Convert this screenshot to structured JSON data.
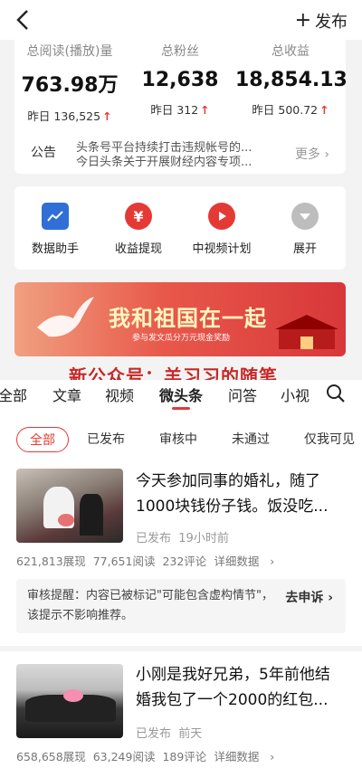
{
  "header": {
    "publish_label": "发布",
    "back_icon": "back-arrow-icon"
  },
  "stats": [
    {
      "label": "总阅读(播放)量",
      "value": "763.98万",
      "yesterday": "昨日 136,525"
    },
    {
      "label": "总粉丝",
      "value": "12,638",
      "yesterday": "昨日 312"
    },
    {
      "label": "总收益",
      "value": "18,854.13",
      "yesterday": "昨日 500.72"
    }
  ],
  "notice": {
    "tag": "公告",
    "line1": "头条号平台持续打击违规帐号的...",
    "line2": "今日头条关于开展财经内容专项...",
    "more": "更多"
  },
  "tools": [
    {
      "label": "数据助手",
      "icon": "chart-icon",
      "color": "#2f6fd6"
    },
    {
      "label": "收益提现",
      "icon": "yuan-icon",
      "color": "#e53935"
    },
    {
      "label": "中视频计划",
      "icon": "video-icon",
      "color": "#e53935"
    },
    {
      "label": "展开",
      "icon": "expand-icon",
      "color": "#bdbdbd"
    }
  ],
  "banner": {
    "title": "我和祖国在一起",
    "subtitle": "参与发文瓜分万元现金奖励"
  },
  "watermark": "新公众号：羊习习的随笔",
  "tabs": [
    "全部",
    "文章",
    "视频",
    "微头条",
    "问答",
    "小视"
  ],
  "active_tab": "微头条",
  "filters": [
    "全部",
    "已发布",
    "审核中",
    "未通过",
    "仅我可见"
  ],
  "active_filter": "全部",
  "posts": [
    {
      "title": "今天参加同事的婚礼，随了1000块钱份子钱。饭没吃...",
      "status": "已发布",
      "time": "19小时前",
      "views": "621,813展现",
      "reads": "77,651阅读",
      "comments": "232评论",
      "details": "详细数据"
    },
    {
      "title": "小刚是我好兄弟，5年前他结婚我包了一个2000的红包...",
      "status": "已发布",
      "time": "前天",
      "views": "658,658展现",
      "reads": "63,249阅读",
      "comments": "189评论",
      "details": "详细数据"
    }
  ],
  "review": {
    "text": "审核提醒：内容已被标记\"可能包含虚构情节\"，该提示不影响推荐。",
    "appeal": "去申诉"
  },
  "colors": {
    "accent": "#e53935"
  }
}
